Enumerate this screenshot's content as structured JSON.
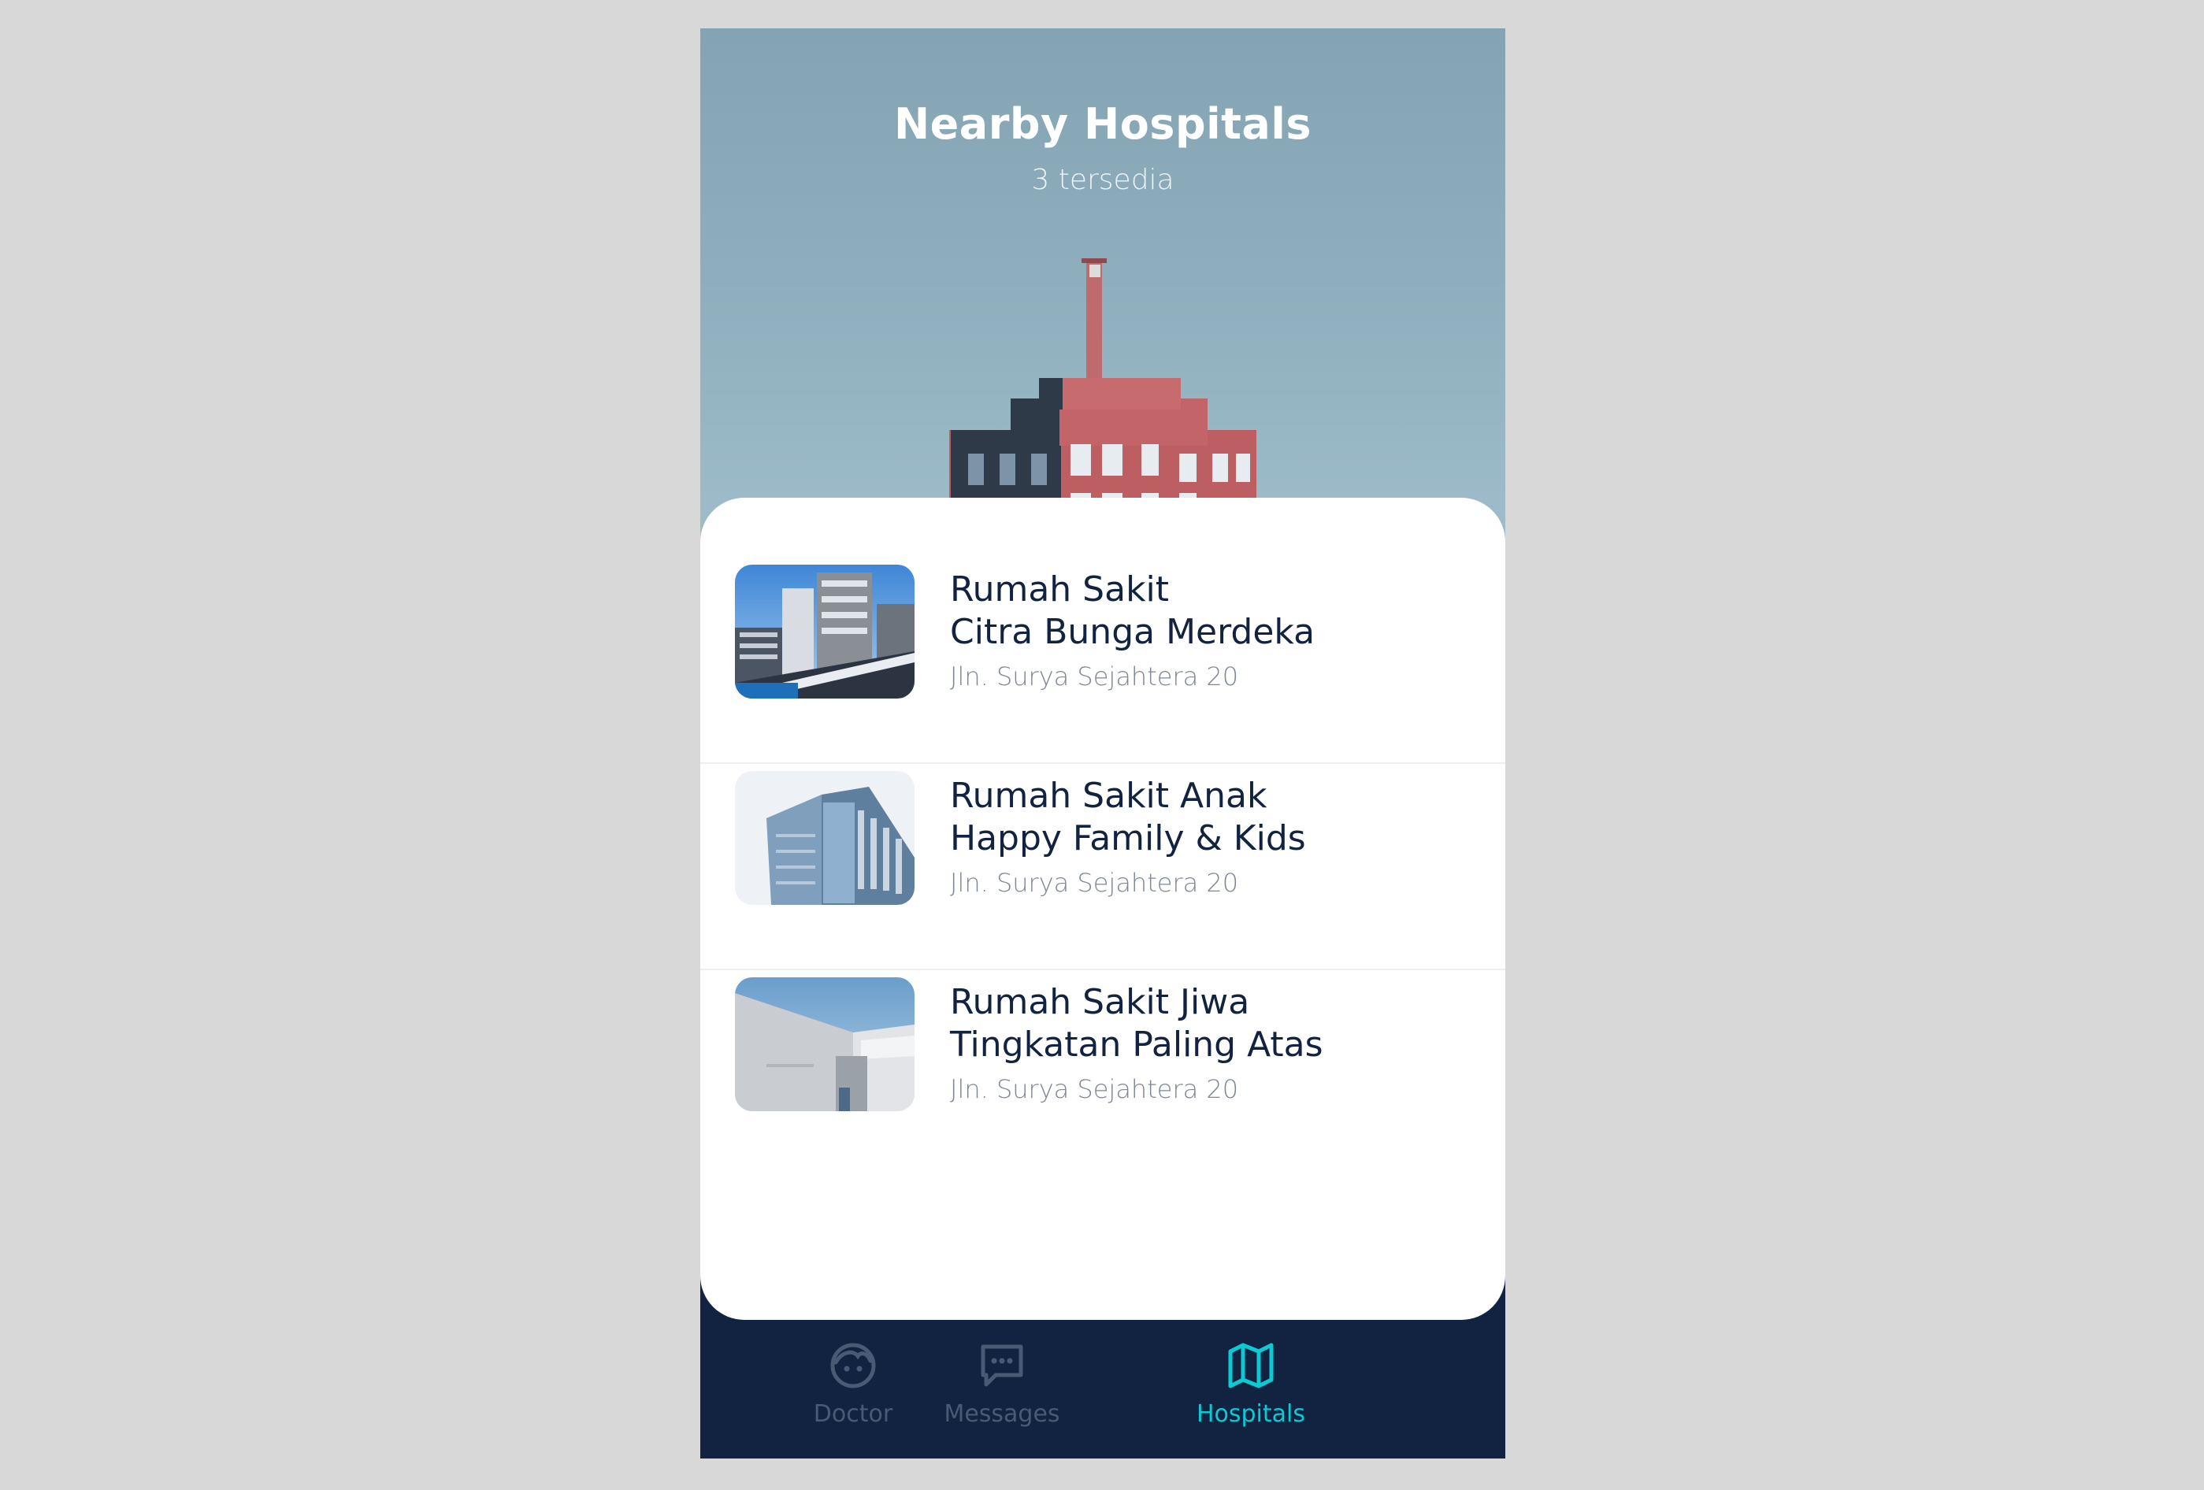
{
  "header": {
    "title": "Nearby Hospitals",
    "subtitle": "3 tersedia"
  },
  "hospitals": [
    {
      "name_line1": "Rumah Sakit",
      "name_line2": "Citra Bunga Merdeka",
      "address": "Jln. Surya Sejahtera 20"
    },
    {
      "name_line1": "Rumah Sakit Anak",
      "name_line2": "Happy Family & Kids",
      "address": "Jln. Surya Sejahtera 20"
    },
    {
      "name_line1": "Rumah Sakit Jiwa",
      "name_line2": "Tingkatan Paling Atas",
      "address": "Jln. Surya Sejahtera 20"
    }
  ],
  "nav": {
    "active": "Hospitals",
    "accent_color": "#0bcad4",
    "inactive_color": "#495a75",
    "items": [
      {
        "label": "Doctor",
        "icon": "doctor-face-icon"
      },
      {
        "label": "Messages",
        "icon": "chat-bubble-icon"
      },
      {
        "label": "Hospitals",
        "icon": "map-icon"
      }
    ]
  },
  "colors": {
    "background": "#d8d8d8",
    "nav_background": "#112340",
    "title_text": "#112340",
    "address_text": "#7d8797"
  }
}
